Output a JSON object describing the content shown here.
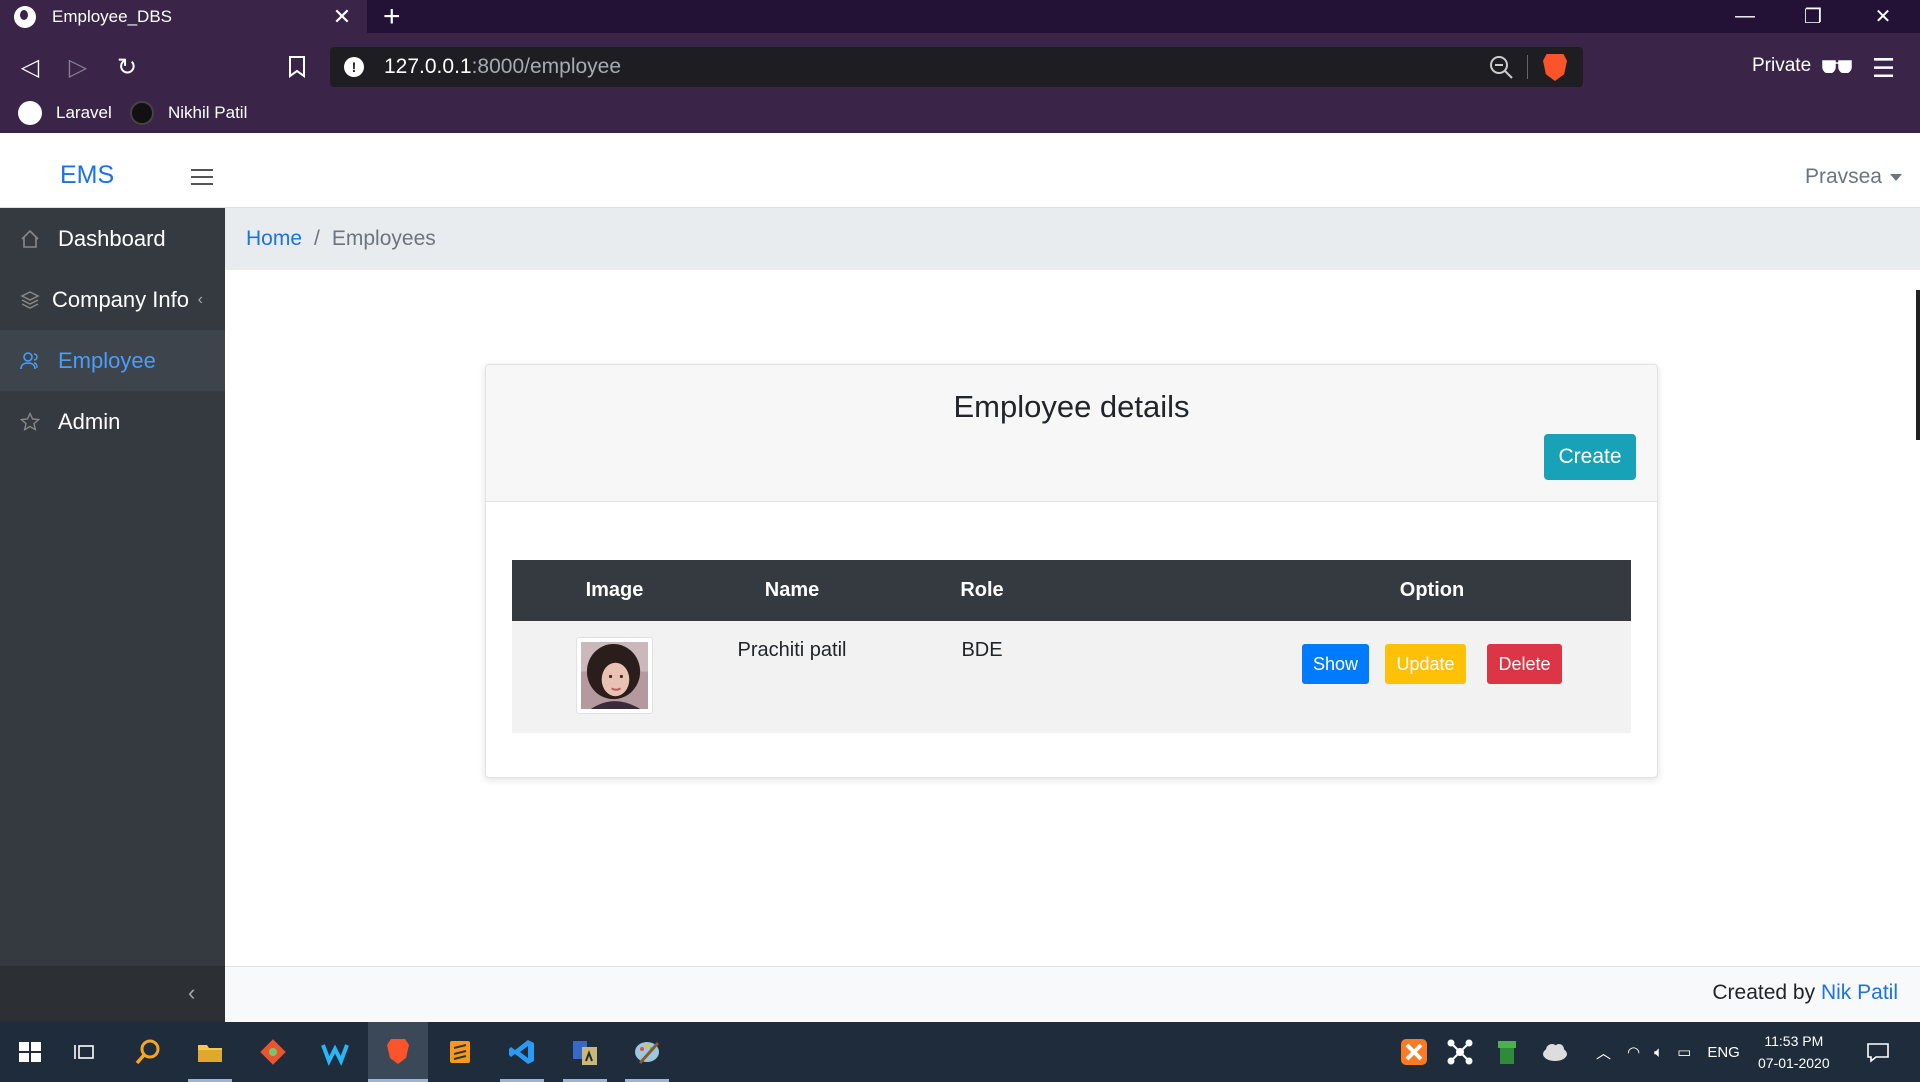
{
  "browser": {
    "tab_title": "Employee_DBS",
    "url_host": "127.0.0.1",
    "url_path": ":8000/employee",
    "private_label": "Private",
    "bookmarks": [
      "Laravel",
      "Nikhil Patil"
    ]
  },
  "app": {
    "brand": "EMS",
    "user": "Pravsea"
  },
  "sidebar": {
    "items": [
      {
        "label": "Dashboard",
        "icon": "home-icon"
      },
      {
        "label": "Company Info",
        "icon": "layers-icon"
      },
      {
        "label": "Employee",
        "icon": "users-icon",
        "active": true
      },
      {
        "label": "Admin",
        "icon": "star-icon"
      }
    ]
  },
  "breadcrumb": {
    "home": "Home",
    "separator": "/",
    "current": "Employees"
  },
  "card": {
    "title": "Employee details",
    "create_label": "Create"
  },
  "table": {
    "headers": [
      "Image",
      "Name",
      "Role",
      "Option"
    ],
    "rows": [
      {
        "name": "Prachiti patil",
        "role": "BDE"
      }
    ],
    "actions": {
      "show": "Show",
      "update": "Update",
      "delete": "Delete"
    }
  },
  "footer": {
    "prefix": "Created by",
    "author": "Nik Patil"
  },
  "taskbar": {
    "time": "11:53 PM",
    "date": "07-01-2020",
    "lang": "ENG"
  },
  "colors": {
    "brand_blue": "#1a73e8",
    "sidebar_bg": "#343a40",
    "create": "#17a2b8",
    "show": "#007bff",
    "update": "#ffc107",
    "delete": "#dc3545"
  }
}
